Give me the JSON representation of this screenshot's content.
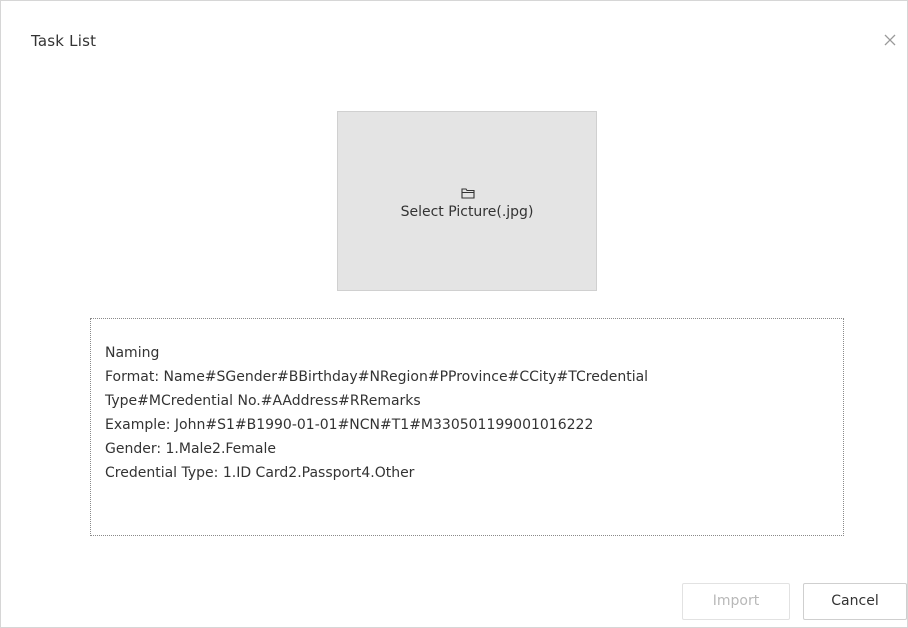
{
  "dialog": {
    "title": "Task List",
    "close_icon": "close-icon"
  },
  "picture_selector": {
    "icon": "folder-icon",
    "label": "Select Picture(.jpg)"
  },
  "instructions": {
    "lines": [
      "Naming",
      "Format: Name#SGender#BBirthday#NRegion#PProvince#CCity#TCredential",
      "Type#MCredential No.#AAddress#RRemarks",
      "Example: John#S1#B1990-01-01#NCN#T1#M330501199001016222",
      "Gender: 1.Male2.Female",
      "Credential Type: 1.ID Card2.Passport4.Other"
    ]
  },
  "footer": {
    "import_label": "Import",
    "import_enabled": false,
    "cancel_label": "Cancel"
  },
  "colors": {
    "picture_box_bg": "#e4e4e4",
    "disabled_text": "#b8b8b8",
    "border": "#cfcfcf"
  }
}
